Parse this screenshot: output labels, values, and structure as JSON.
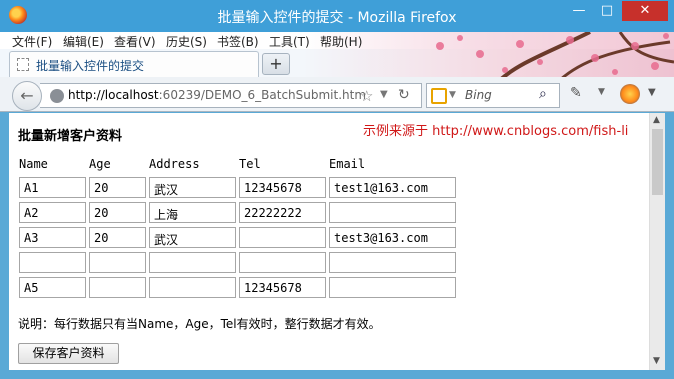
{
  "window": {
    "title": "批量输入控件的提交 - Mozilla Firefox",
    "minimize": "—",
    "maximize": "□",
    "close": "✕"
  },
  "menu": [
    "文件(F)",
    "编辑(E)",
    "查看(V)",
    "历史(S)",
    "书签(B)",
    "工具(T)",
    "帮助(H)"
  ],
  "tab": {
    "label": "批量输入控件的提交",
    "new_tab": "+"
  },
  "nav": {
    "url_host": "http://localhost",
    "url_rest": ":60239/DEMO_6_BatchSubmit.htm",
    "search_placeholder": "Bing"
  },
  "page": {
    "title": "批量新增客户资料",
    "source_note": "示例来源于 http://www.cnblogs.com/fish-li",
    "columns": [
      "Name",
      "Age",
      "Address",
      "Tel",
      "Email"
    ],
    "rows": [
      [
        "A1",
        "20",
        "武汉",
        "12345678",
        "test1@163.com"
      ],
      [
        "A2",
        "20",
        "上海",
        "22222222",
        ""
      ],
      [
        "A3",
        "20",
        "武汉",
        "",
        "test3@163.com"
      ],
      [
        "",
        "",
        "",
        "",
        ""
      ],
      [
        "A5",
        "",
        "",
        "12345678",
        ""
      ]
    ],
    "note": "说明：每行数据只有当Name，Age，Tel有效时，整行数据才有效。",
    "save_label": "保存客户资料"
  },
  "colors": {
    "titlebar": "#3f9fd8",
    "source_red": "#d01818",
    "close_red": "#c7302b"
  }
}
